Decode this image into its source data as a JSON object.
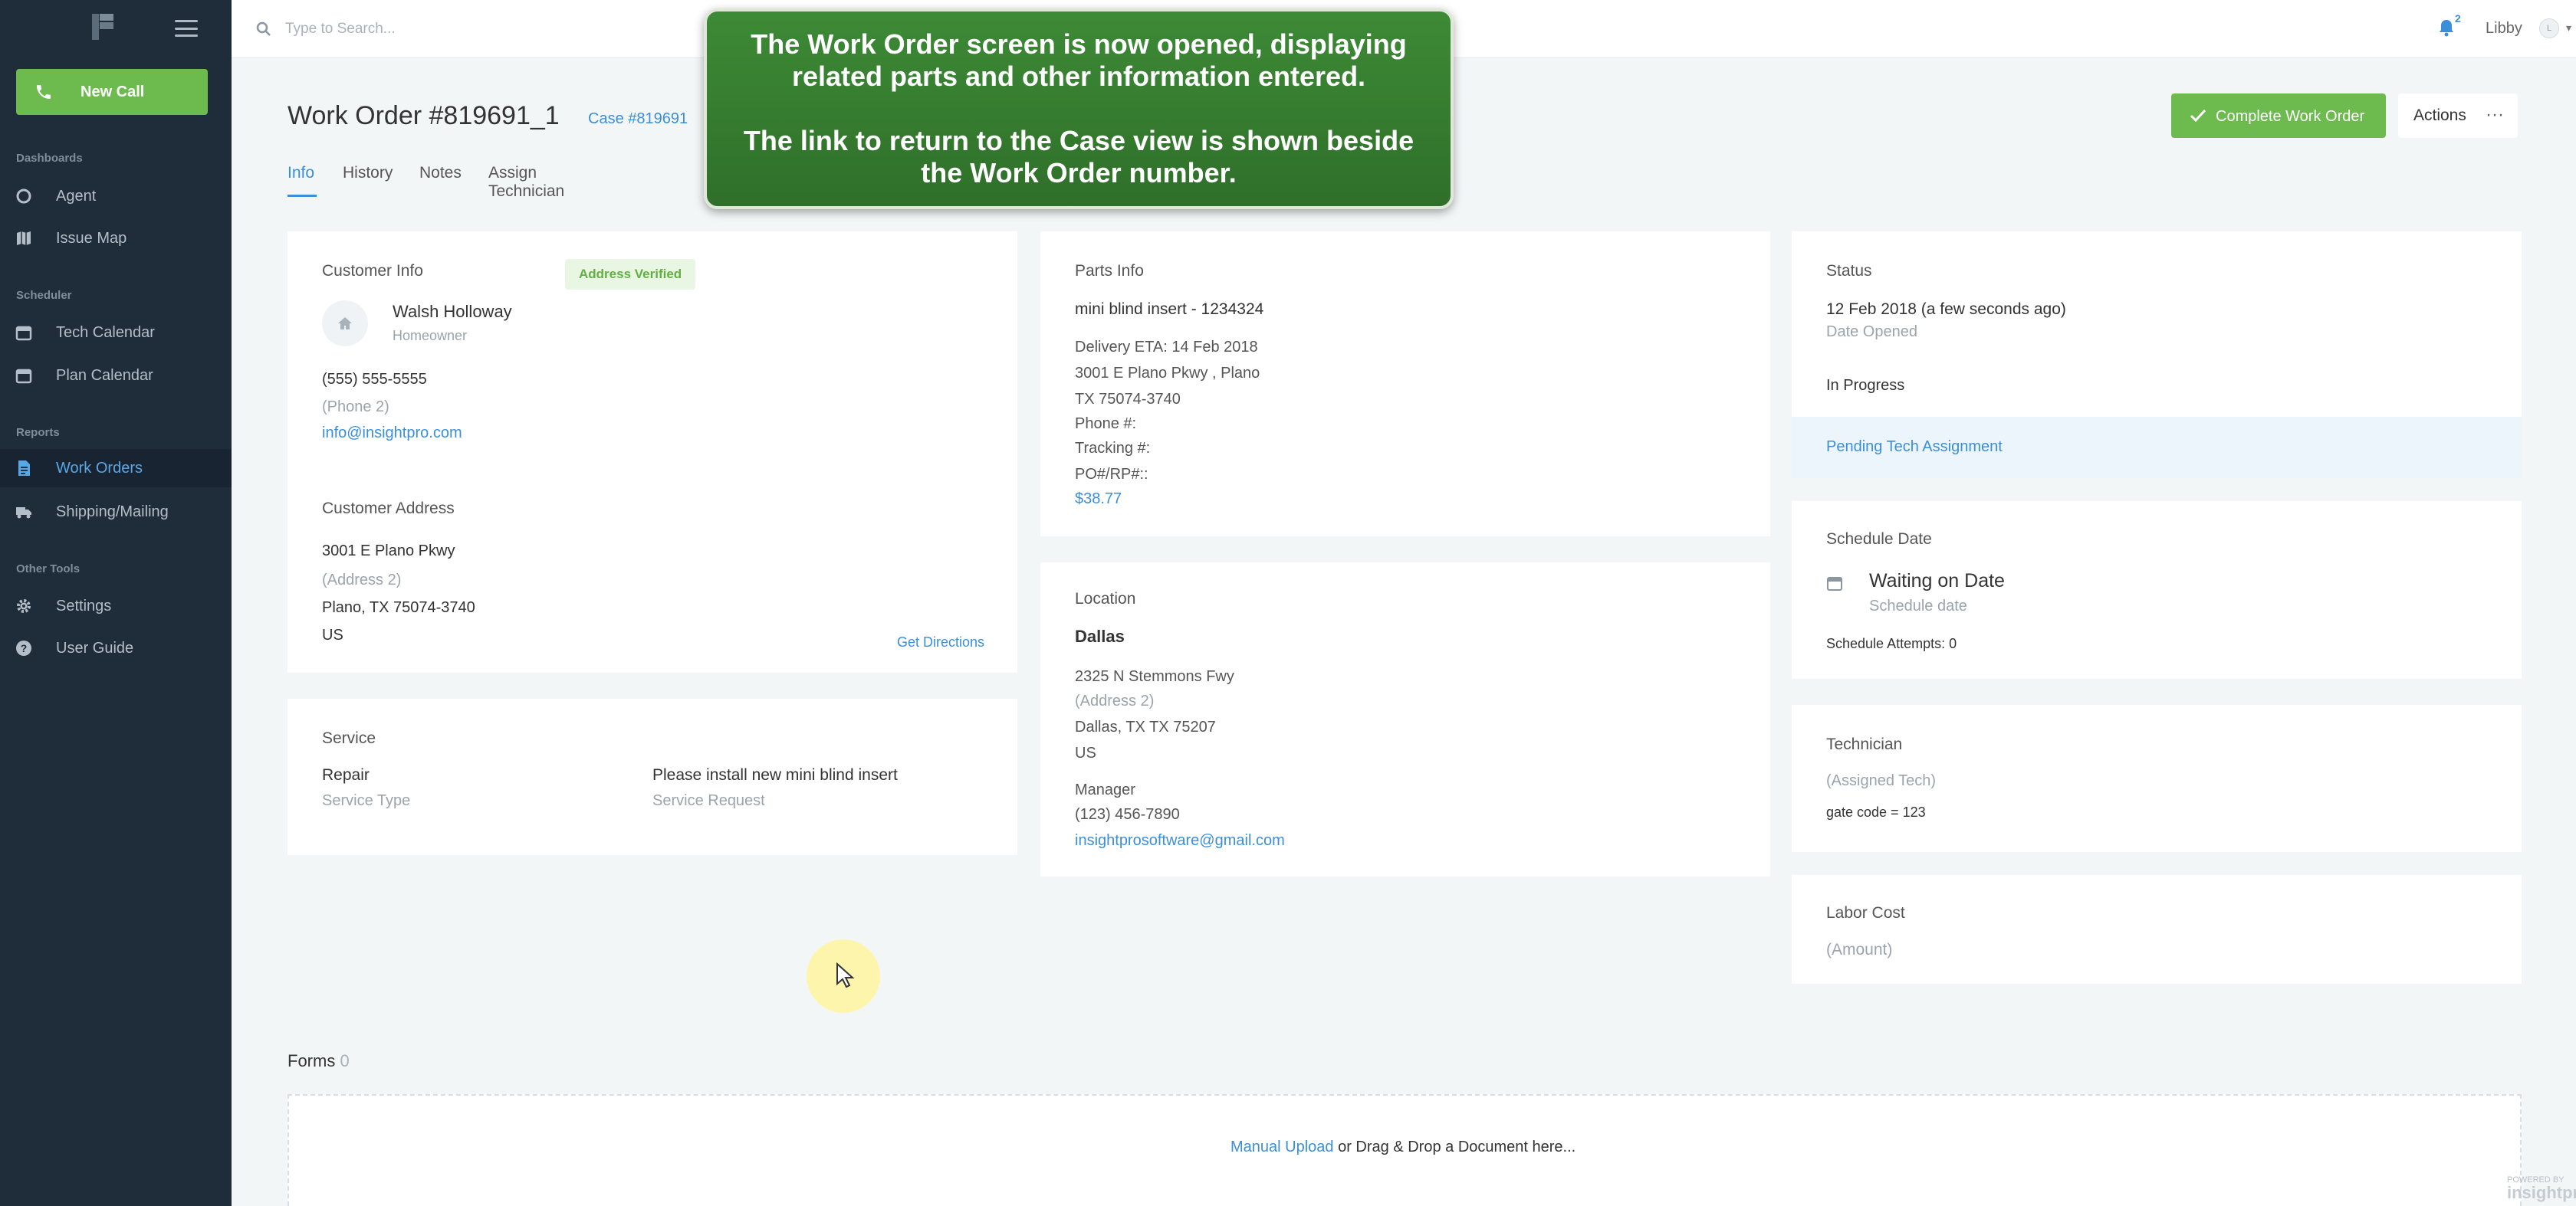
{
  "sidebar": {
    "new_call_label": "New Call",
    "sections": {
      "dashboards": "Dashboards",
      "scheduler": "Scheduler",
      "reports": "Reports",
      "other_tools": "Other Tools"
    },
    "items": {
      "agent": "Agent",
      "issue_map": "Issue Map",
      "tech_calendar": "Tech Calendar",
      "plan_calendar": "Plan Calendar",
      "work_orders": "Work Orders",
      "shipping": "Shipping/Mailing",
      "settings": "Settings",
      "user_guide": "User Guide"
    },
    "active_item": "Work Orders"
  },
  "topbar": {
    "search_placeholder": "Type to Search...",
    "notification_count": "2",
    "user_name": "Libby",
    "user_initial": "L"
  },
  "tooltip": {
    "line1": "The Work Order screen is now opened, displaying\nrelated parts and other information entered.",
    "line2": "The link to return to the Case view is shown beside\nthe Work Order number."
  },
  "header": {
    "title": "Work Order #819691_1",
    "case_link": "Case #819691",
    "complete_label": "Complete Work Order",
    "actions_label": "Actions",
    "actions_dots": "···"
  },
  "tabs": [
    "Info",
    "History",
    "Notes",
    "Assign Technician"
  ],
  "customer": {
    "heading": "Customer Info",
    "name": "Walsh Holloway",
    "role": "Homeowner",
    "phone": "(555) 555-5555",
    "phone2": "(Phone 2)",
    "email": "info@insightpro.com",
    "address_heading": "Customer Address",
    "address_badge": "Address Verified",
    "address1": "3001 E Plano Pkwy",
    "address2": "(Address 2)",
    "city": "Plano, TX 75074-3740",
    "country": "US",
    "directions": "Get Directions"
  },
  "service": {
    "heading": "Service",
    "type_value": "Repair",
    "type_label": "Service Type",
    "request_value": "Please install new mini blind insert",
    "request_label": "Service Request"
  },
  "parts": {
    "heading": "Parts Info",
    "part": "mini blind insert - 1234324",
    "delivery_eta": "Delivery ETA: 14 Feb 2018",
    "address1": "3001 E Plano Pkwy , Plano",
    "address2": "TX 75074-3740",
    "phone": "Phone #:",
    "tracking": "Tracking #:",
    "po": "PO#/RP#::",
    "price": "$38.77"
  },
  "location": {
    "heading": "Location",
    "name": "Dallas",
    "address1": "2325 N Stemmons Fwy",
    "address2": "(Address 2)",
    "city": "Dallas, TX TX 75207",
    "country": "US",
    "manager_label": "Manager",
    "phone": "(123) 456-7890",
    "email": "insightprosoftware@gmail.com"
  },
  "status": {
    "heading": "Status",
    "date": "12 Feb 2018 (a few seconds ago)",
    "date_label": "Date Opened",
    "state": "In Progress",
    "pending": "Pending Tech Assignment"
  },
  "schedule": {
    "heading": "Schedule Date",
    "value": "Waiting on Date",
    "sub": "Schedule date",
    "attempts": "Schedule Attempts: 0"
  },
  "technician": {
    "heading": "Technician",
    "assigned": "(Assigned Tech)",
    "note": "gate code = 123"
  },
  "labor": {
    "heading": "Labor Cost",
    "amount": "(Amount)"
  },
  "forms": {
    "title": "Forms",
    "count": "0",
    "upload_link": "Manual Upload",
    "upload_text": " or Drag & Drop a Document here..."
  },
  "footer": {
    "powered_small": "POWERED BY",
    "powered_brand": "insightpro"
  },
  "colors": {
    "sidebar_bg": "#1f2d3b",
    "accent_green": "#6dbb4f",
    "link_blue": "#3b8fd8",
    "tooltip_green": "#3d8a36"
  }
}
